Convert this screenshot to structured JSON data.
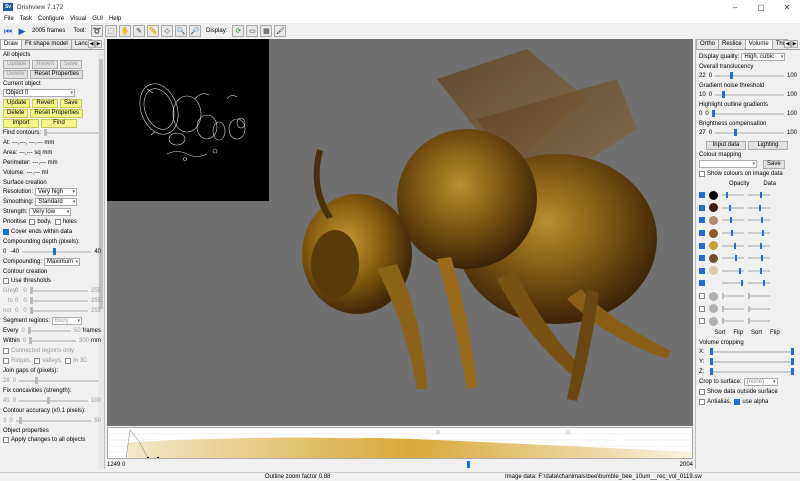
{
  "window": {
    "logo": "Sv",
    "title": "Drishview 7.172",
    "controls": [
      "–",
      "▢",
      "✕"
    ]
  },
  "menu": [
    "File",
    "Task",
    "Configure",
    "Visual",
    "GUI",
    "Help"
  ],
  "toolbar": {
    "frames": "2005 frames",
    "tool_label": "Tool:",
    "display_label": "Display:"
  },
  "left": {
    "tabs": [
      "Draw",
      "Fit shape model",
      "Lanc"
    ],
    "all_objects": {
      "title": "All objects",
      "update": "Update",
      "revert": "Revert",
      "save": "Save",
      "delete": "Delete",
      "reset": "Reset Properties"
    },
    "current_object": {
      "title": "Current object",
      "selected": "Object 0",
      "update": "Update",
      "revert": "Revert",
      "save": "Save",
      "delete": "Delete",
      "reset": "Reset Properties",
      "import": "Import",
      "find": "Find"
    },
    "find_contours": "Find contours:",
    "at": "At:  ---,---, ---,--- mm",
    "area": "Area: ---,--- sq mm",
    "perimeter": "Perimeter: ---,--- mm",
    "volume": "Volume: ---,--- ml",
    "surface": {
      "title": "Surface creation",
      "resolution_label": "Resolution:",
      "resolution": "Very high",
      "smoothing_label": "Smoothing:",
      "smoothing": "Standard",
      "strength_label": "Strength:",
      "strength": "Very low",
      "prioritise": "Prioritise",
      "body": "body,",
      "holes": "holes",
      "cover": "Cover ends within data",
      "compounding_depth": "Compounding depth (pixels):",
      "cd_min": "0",
      "cd_val": "-40",
      "cd_max": "40",
      "compounding_label": "Compounding:",
      "compounding": "Maximum"
    },
    "contour": {
      "title": "Contour creation",
      "use_thresholds": "Use thresholds",
      "grey": "Grey:",
      "to": "to",
      "not": "not",
      "zero": "0",
      "max": "255",
      "segment": "Segment regions:",
      "segment_val": "Body",
      "every": "Every",
      "every_min": "0",
      "every_val": "50",
      "frames": "frames",
      "within": "Within",
      "within_min": "0",
      "within_val": "300",
      "mm": "mm",
      "connected": "Connected regions only",
      "ridges": "Ridges,",
      "valleys": "valleys,",
      "in3d": "in 3D",
      "join_gaps": "Join gaps of (pixels):",
      "jg_min": "28",
      "jg_val": "0",
      "fix_conc": "Fix concavities (strength):",
      "fc_min": "41",
      "fc_val": "0",
      "fc_max": "100",
      "accuracy": "Contour accuracy (x0.1 pixels):",
      "ac_min": "3",
      "ac_val": "0",
      "ac_max": "50"
    },
    "object_props": {
      "title": "Object properties",
      "apply": "Apply changes to all objects"
    }
  },
  "right": {
    "tabs": [
      "Ortho",
      "Reslice",
      "Volume",
      "Thi"
    ],
    "display_quality_label": "Display quality:",
    "display_quality": "High, cubic",
    "translucency": {
      "label": "Overall translucency",
      "val": "22",
      "min": "0",
      "max": "100"
    },
    "gradient": {
      "label": "Gradient noise threshold",
      "val": "10",
      "min": "0",
      "max": "100"
    },
    "highlight": {
      "label": "Highlight outline gradients",
      "val": "0",
      "min": "0",
      "max": "100"
    },
    "brightness": {
      "label": "Brightness compensation",
      "val": "27",
      "min": "0",
      "max": "100"
    },
    "input_data": "Input data",
    "lighting": "Lighting",
    "colour_mapping": "Colour mapping",
    "save": "Save",
    "show_colours": "Show colours on image data",
    "opacity": "Opacity",
    "data": "Data",
    "sort": "Sort",
    "flip": "Flip",
    "volume_cropping": "Volume cropping",
    "x": "X:",
    "y": "Y:",
    "z": "Z:",
    "crop_to_surface": "Crop to surface:",
    "crop_val": "(none)",
    "show_outside": "Show data outside surface",
    "antialias": "Antialias,",
    "use_alpha": "use alpha"
  },
  "histogram": {
    "left_label": "1249 0",
    "right_label": "2004"
  },
  "status": {
    "zoom": "Outline zoom factor 0.88",
    "image_data": "Image data: F:\\data\\ct\\animals\\bee\\bumble_bee_10um__rec_vol_0119.sw"
  },
  "colors": {
    "accent": "#1e6fd9",
    "highlight_btn": "#f5f58a",
    "viewport_bg": "#707070"
  },
  "swatches": [
    "#000000",
    "#3a1c10",
    "#b48a70",
    "#8a5a20",
    "#c8a030",
    "#705030",
    "#d8c8b0",
    "#f0f0f0",
    "#b0b0b0",
    "#b0b0b0",
    "#b0b0b0"
  ]
}
